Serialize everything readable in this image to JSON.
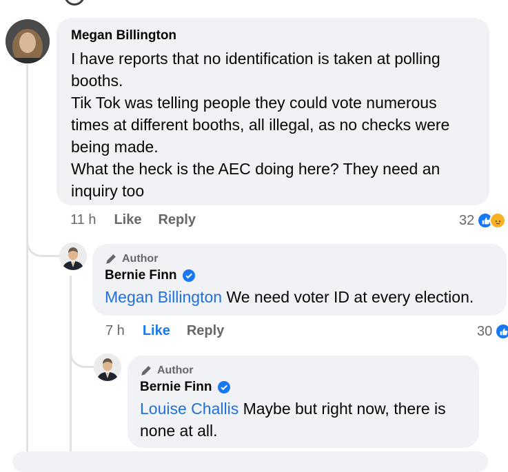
{
  "comments": [
    {
      "author": "Megan Billington",
      "lines": [
        "I have reports that no identification is taken at polling",
        "booths.",
        "Tik Tok was telling people they could vote numerous",
        "times at different booths, all illegal, as no checks were",
        "being made.",
        "What the heck is the AEC doing here? They need an",
        "inquiry too"
      ],
      "time": "11 h",
      "like_label": "Like",
      "reply_label": "Reply",
      "reaction_count": "32"
    },
    {
      "badge": "Author",
      "author": "Bernie Finn",
      "mention": "Megan Billington",
      "text": " We need voter ID at every election.",
      "time": "7 h",
      "like_label": "Like",
      "reply_label": "Reply",
      "reaction_count": "30"
    },
    {
      "badge": "Author",
      "author": "Bernie Finn",
      "mention": "Louise Challis",
      "text_line1": " Maybe but right now, there is",
      "text_line2": "none at all."
    }
  ],
  "colors": {
    "mention": "#216fdb",
    "like_active": "#1877f2",
    "bubble": "#f0f2f5",
    "meta": "#65676b"
  },
  "icons": [
    "pencil-icon",
    "verified-badge-icon",
    "like-reaction-icon",
    "angry-reaction-icon"
  ]
}
